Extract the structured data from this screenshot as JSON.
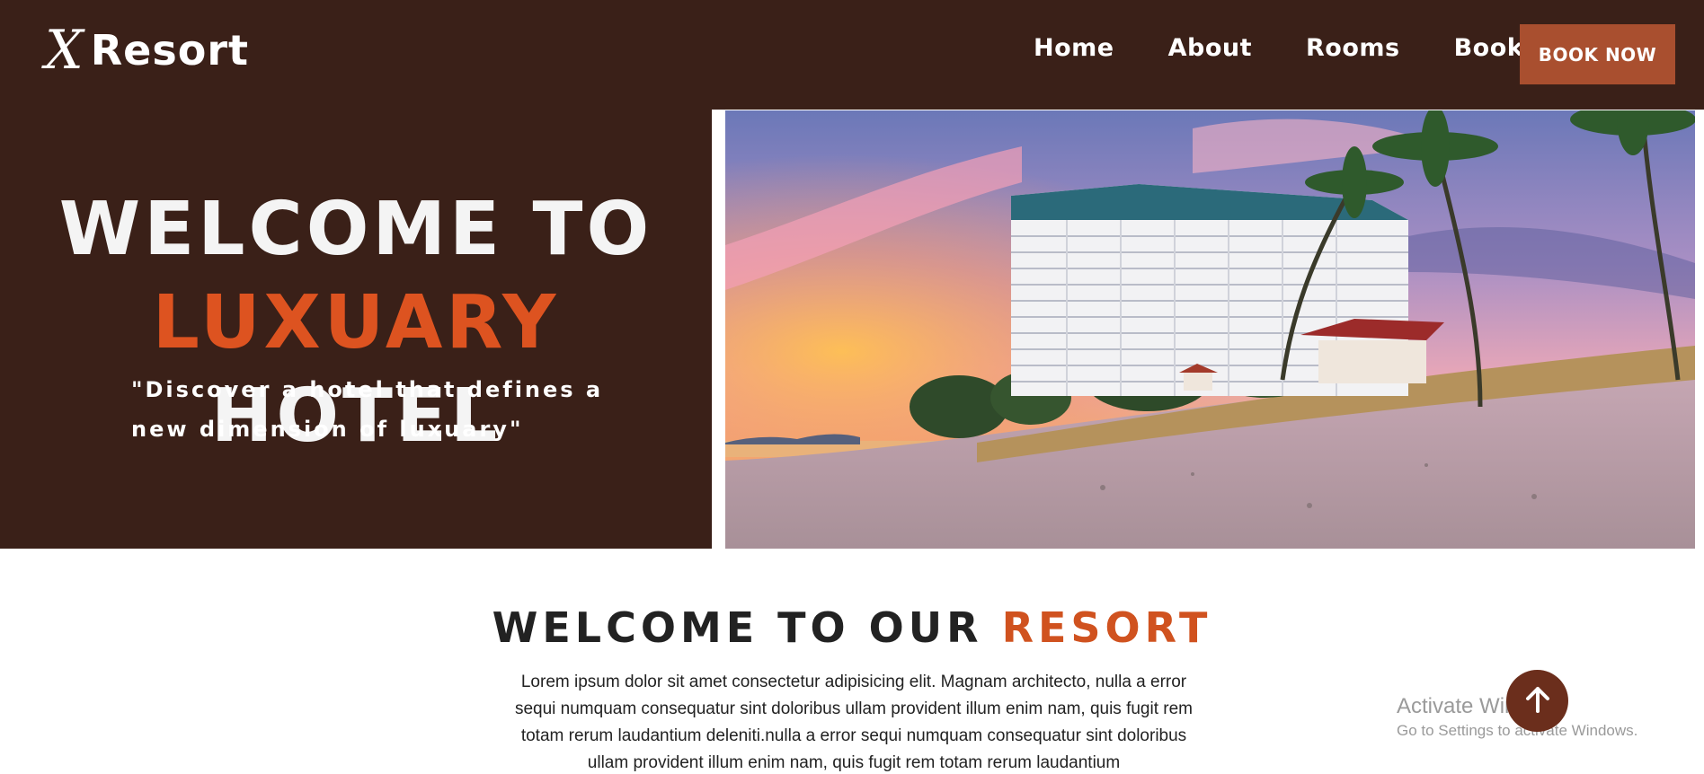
{
  "brand": {
    "mark": "X",
    "name": "Resort"
  },
  "nav": {
    "items": [
      "Home",
      "About",
      "Rooms",
      "Booking"
    ]
  },
  "header": {
    "cta_label": "BOOK NOW"
  },
  "hero": {
    "title_line1": "WELCOME TO",
    "title_accent": "LUXUARY",
    "title_rest": "HOTEL",
    "quote": "\"Discover a hotel that defines a new dimension of luxuary\""
  },
  "welcome": {
    "title_plain": "WELCOME TO OUR",
    "title_accent": "RESORT",
    "text": "Lorem ipsum dolor sit amet consectetur adipisicing elit. Magnam architecto, nulla a error sequi numquam consequatur sint doloribus ullam provident illum enim nam, quis fugit rem totam rerum laudantium deleniti.nulla a error sequi numquam consequatur sint doloribus ullam provident illum enim nam, quis fugit rem totam rerum laudantium"
  },
  "watermark": {
    "title": "Activate Windows",
    "subtitle": "Go to Settings to activate Windows."
  },
  "icons": {
    "scroll_top": "arrow-up-icon"
  },
  "colors": {
    "header_bg": "#3a2018",
    "accent": "#dd5320",
    "button_bg": "#a94f2f",
    "scroll_top_bg": "#6b2e1c"
  }
}
